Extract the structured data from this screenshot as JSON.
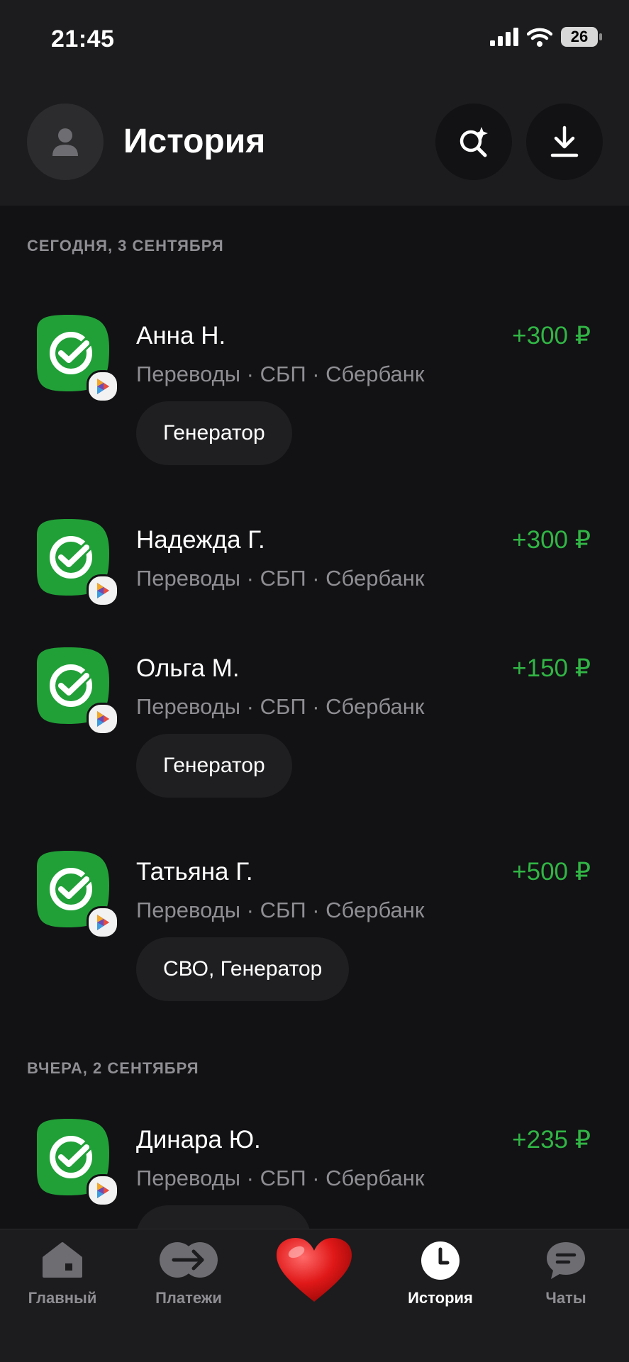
{
  "status_bar": {
    "time": "21:45",
    "battery": "26"
  },
  "header": {
    "title": "История"
  },
  "sections": [
    {
      "label": "СЕГОДНЯ, 3 СЕНТЯБРЯ"
    },
    {
      "label": "ВЧЕРА, 2 СЕНТЯБРЯ"
    }
  ],
  "transactions": [
    {
      "name": "Анна Н.",
      "details": "Переводы · СБП · Сбербанк",
      "amount": "+300 ₽",
      "tag": "Генератор"
    },
    {
      "name": "Надежда Г.",
      "details": "Переводы · СБП · Сбербанк",
      "amount": "+300 ₽",
      "tag": ""
    },
    {
      "name": "Ольга М.",
      "details": "Переводы · СБП · Сбербанк",
      "amount": "+150 ₽",
      "tag": "Генератор"
    },
    {
      "name": "Татьяна Г.",
      "details": "Переводы · СБП · Сбербанк",
      "amount": "+500 ₽",
      "tag": "СВО, Генератор"
    },
    {
      "name": "Динара Ю.",
      "details": "Переводы · СБП · Сбербанк",
      "amount": "+235 ₽",
      "tag": ""
    }
  ],
  "tabbar": {
    "items": [
      {
        "label": "Главный",
        "icon": "home-icon"
      },
      {
        "label": "Платежи",
        "icon": "transfer-icon"
      },
      {
        "label": "",
        "icon": "heart-icon"
      },
      {
        "label": "История",
        "icon": "clock-icon",
        "active": true
      },
      {
        "label": "Чаты",
        "icon": "chat-icon"
      }
    ]
  },
  "colors": {
    "accent_green": "#31b545",
    "sber_green": "#21a038",
    "background": "#121214",
    "surface": "#1c1c1e"
  }
}
